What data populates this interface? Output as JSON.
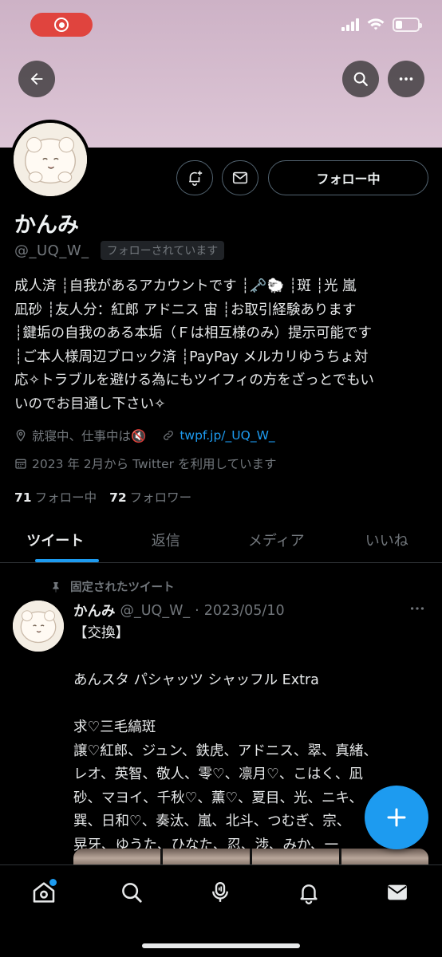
{
  "colors": {
    "accent": "#1d9bf0",
    "banner": "#d6bccf",
    "record": "#e0443e"
  },
  "header": {
    "back_icon": "arrow-left-icon",
    "search_icon": "search-icon",
    "more_icon": "more-horizontal-icon"
  },
  "profile": {
    "name": "かんみ",
    "handle": "@_UQ_W_",
    "follows_you": "フォローされています",
    "follow_button": "フォロー中",
    "bio_lines": [
      "成人済 ┊自我があるアカウントです ┊🗝️🐑 ┊斑 ┊光 嵐",
      "凪砂 ┊友人分：紅郎 アドニス 宙 ┊お取引経験あります",
      "┊鍵垢の自我のある本垢（Ｆは相互様のみ）提示可能です",
      "┊ご本人様周辺ブロック済 ┊PayPay メルカリゆうちょ対",
      "応✧トラブルを避ける為にもツイフィの方をざっとでもい",
      "いのでお目通し下さい✧"
    ],
    "location": "就寝中、仕事中は🔇",
    "link": "twpf.jp/_UQ_W_",
    "joined": "2023 年 2月から Twitter を利用しています",
    "following_count": "71",
    "following_label": "フォロー中",
    "followers_count": "72",
    "followers_label": "フォロワー"
  },
  "tabs": [
    {
      "label": "ツイート",
      "active": true
    },
    {
      "label": "返信",
      "active": false
    },
    {
      "label": "メディア",
      "active": false
    },
    {
      "label": "いいね",
      "active": false
    }
  ],
  "pinned_tweet": {
    "pinned_label": "固定されたツイート",
    "author_name": "かんみ",
    "author_handle": "@_UQ_W_",
    "date": "2023/05/10",
    "separator": "·",
    "lines": [
      "【交換】",
      "",
      "あんスタ パシャッツ シャッフル Extra",
      "",
      "求♡三毛縞斑",
      "譲♡紅郎、ジュン、鉄虎、アドニス、翠、真緒、",
      "レオ、英智、敬人、零♡、凛月♡、こはく、凪",
      "砂、マヨイ、千秋♡、薫♡、夏目、光、ニキ、",
      "巽、日和♡、奏汰、嵐、北斗、つむぎ、宗、",
      "晃牙、ゆうた、ひなた、忍、渉、みか、一"
    ]
  },
  "bottom_nav": [
    {
      "name": "home-icon",
      "has_badge": true
    },
    {
      "name": "search-icon"
    },
    {
      "name": "spaces-icon"
    },
    {
      "name": "notifications-icon"
    },
    {
      "name": "messages-icon"
    }
  ]
}
